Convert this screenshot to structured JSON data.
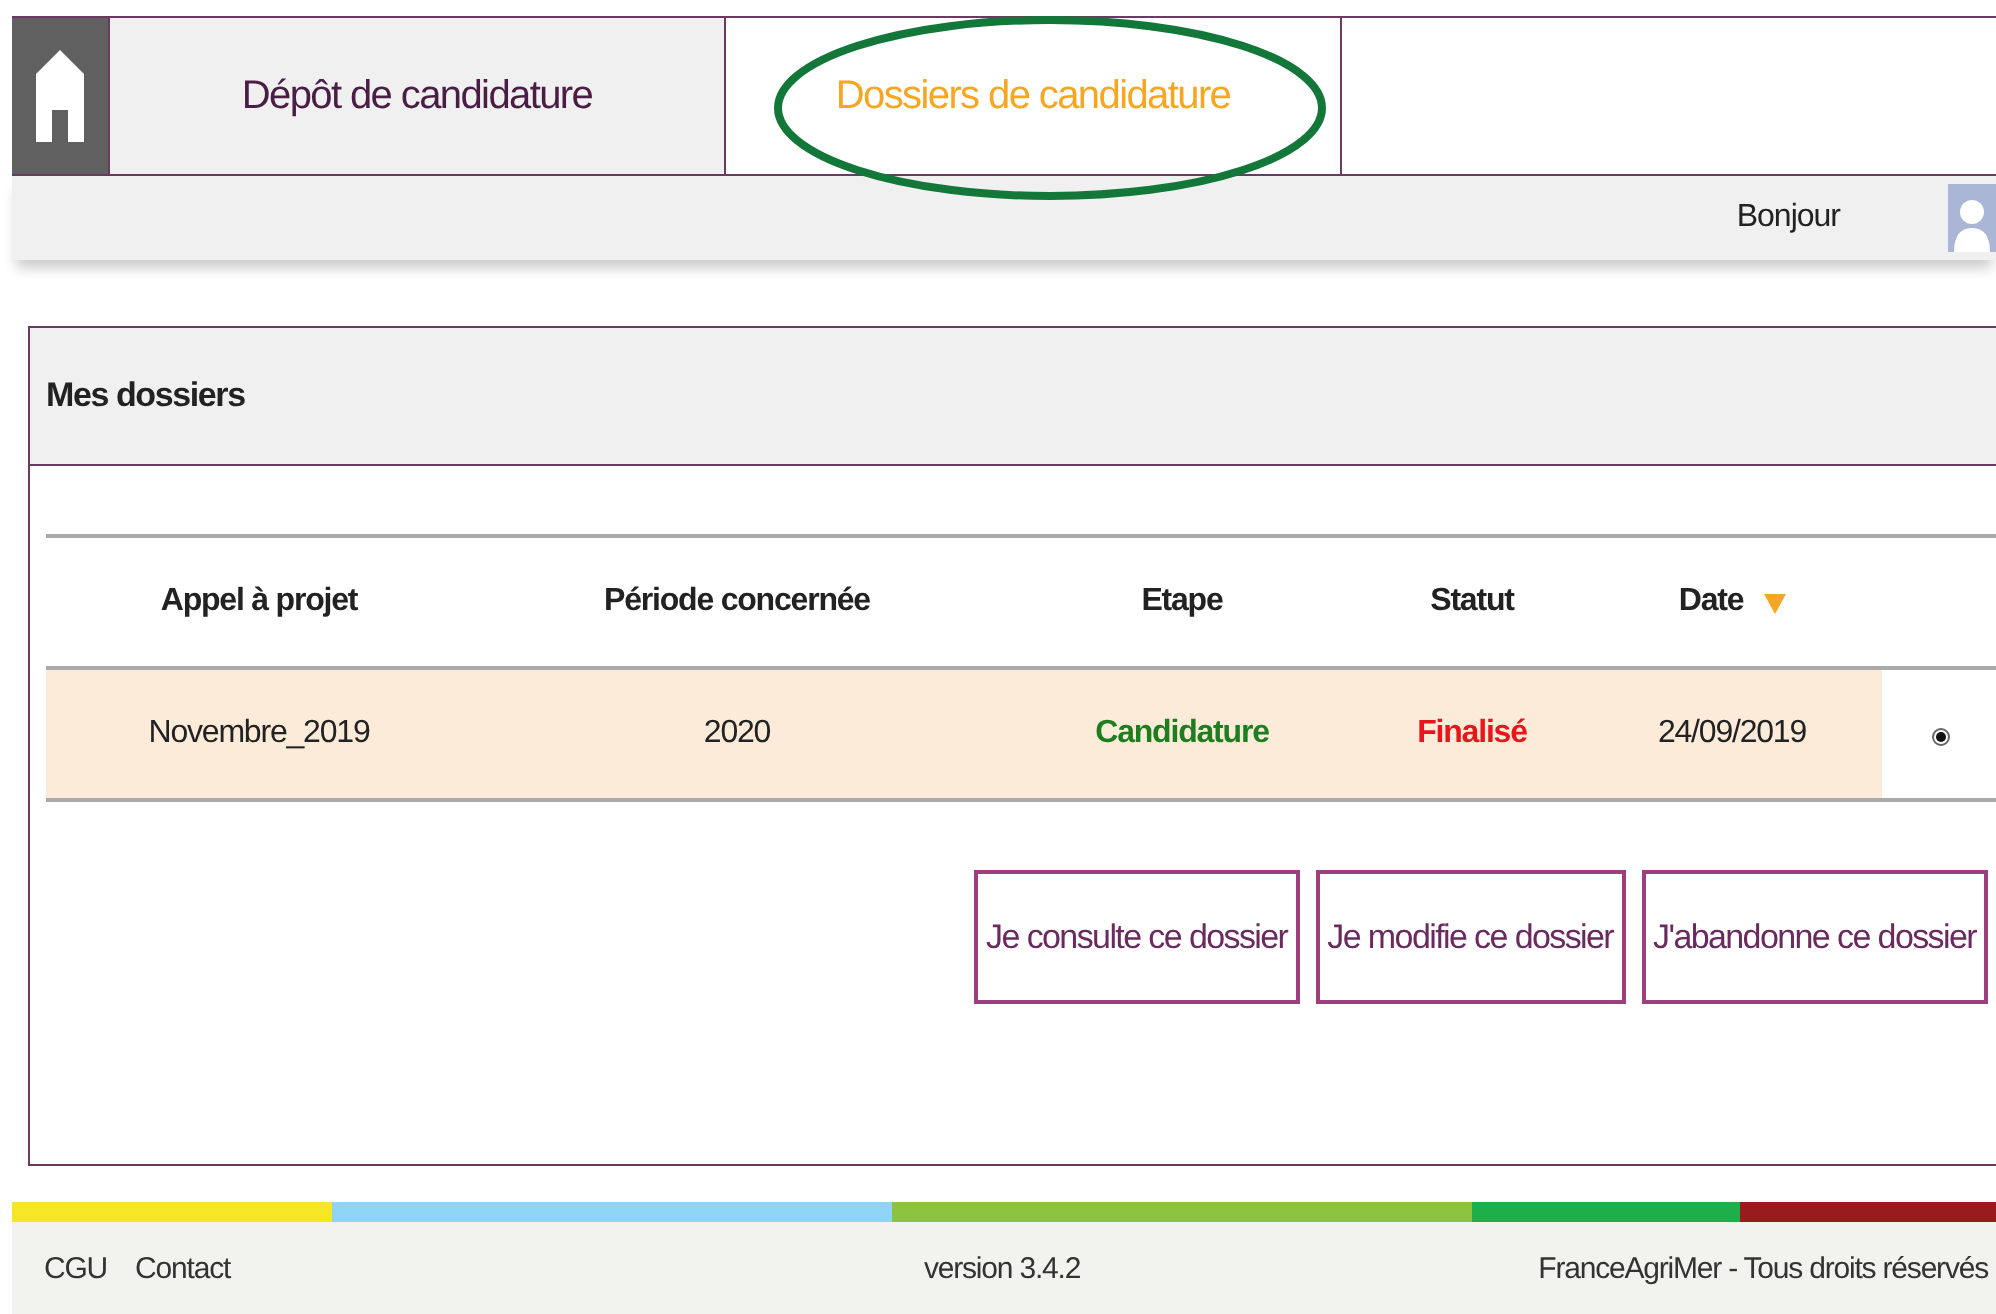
{
  "tabs": [
    {
      "label": "Dépôt de candidature",
      "selected": false
    },
    {
      "label": "Dossiers de candidature",
      "selected": true
    }
  ],
  "greeting": "Bonjour",
  "panel": {
    "title": "Mes dossiers"
  },
  "table": {
    "columns": [
      {
        "label": "Appel à projet",
        "sorted": false
      },
      {
        "label": "Période concernée",
        "sorted": false
      },
      {
        "label": "Etape",
        "sorted": false
      },
      {
        "label": "Statut",
        "sorted": false
      },
      {
        "label": "Date",
        "sorted": true
      }
    ],
    "rows": [
      {
        "cells": [
          "Novembre_2019",
          "2020",
          "Candidature",
          "Finalisé",
          "24/09/2019"
        ],
        "selected": true
      }
    ]
  },
  "buttons": [
    "Je consulte ce dossier",
    "Je modifie ce dossier",
    "J'abandonne ce dossier"
  ],
  "footer": {
    "links": [
      "CGU",
      "Contact"
    ],
    "version": "version 3.4.2",
    "copyright": "FranceAgriMer - Tous droits réservés"
  }
}
